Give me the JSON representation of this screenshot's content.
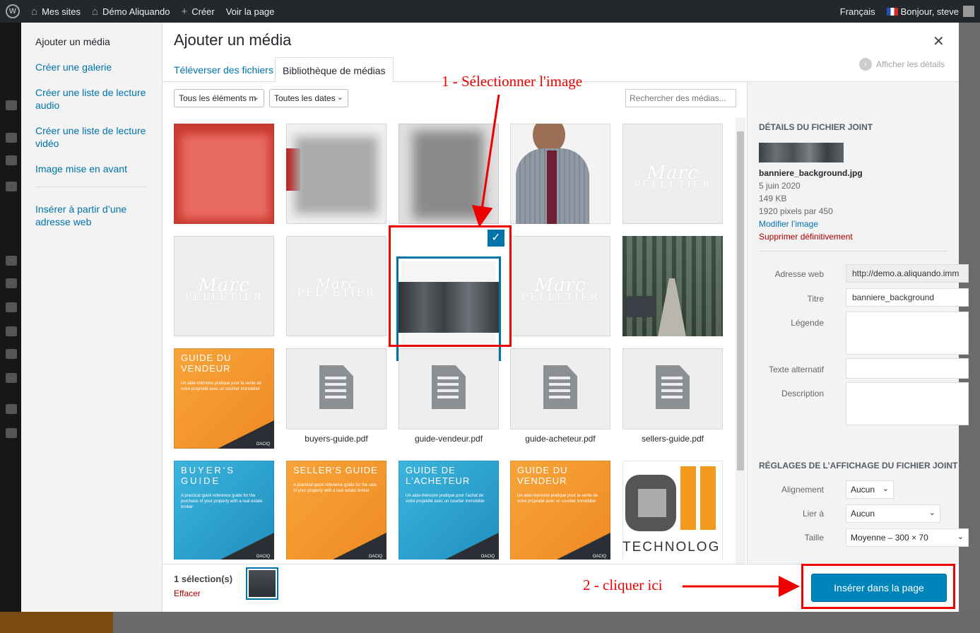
{
  "admin_bar": {
    "my_sites": "Mes sites",
    "site_name": "Démo Aliquando",
    "new": "Créer",
    "view_page": "Voir la page",
    "language": "Français",
    "greeting": "Bonjour, steve"
  },
  "modal": {
    "title": "Ajouter un média",
    "menu": [
      "Ajouter un média",
      "Créer une galerie",
      "Créer une liste de lecture audio",
      "Créer une liste de lecture vidéo",
      "Image mise en avant",
      "Insérer à partir d’une adresse web"
    ],
    "tabs": [
      "Téléverser des fichiers",
      "Bibliothèque de médias"
    ],
    "show_details": "Afficher les détails",
    "filter_type": "Tous les éléments m",
    "filter_date": "Toutes les dates",
    "search_placeholder": "Rechercher des médias...",
    "files": [
      "buyers-guide.pdf",
      "guide-vendeur.pdf",
      "guide-acheteur.pdf",
      "sellers-guide.pdf"
    ],
    "thumb_text": {
      "marc": "Marc",
      "pelletier": "PELLETIER",
      "guide_vendeur": "GUIDE DU VENDEUR",
      "guide_vendeur_sub": "Un aide-mémoire pratique pour la vente de votre propriété avec un courtier immobilier",
      "buyers_guide": "BUYER'S GUIDE",
      "buyers_guide_sub": "A practical quick reference guide for the purchase of your property with a real estate broker",
      "sellers_guide": "SELLER'S GUIDE",
      "sellers_guide_sub": "A practical quick reference guide for the sale of your property with a real estate broker",
      "guide_acheteur": "GUIDE DE L'ACHETEUR",
      "guide_acheteur_sub": "Un aide-mémoire pratique pour l'achat de votre propriété avec un courtier immobilier",
      "oacio": "OACIQ",
      "technology": "TECHNOLOG"
    }
  },
  "details": {
    "heading": "Détails du fichier joint",
    "filename": "banniere_background.jpg",
    "date": "5 juin 2020",
    "size": "149 KB",
    "dimensions": "1920 pixels par 450",
    "edit": "Modifier l’image",
    "delete": "Supprimer définitivement",
    "url_label": "Adresse web",
    "url_value": "http://demo.a.aliquando.imm",
    "title_label": "Titre",
    "title_value": "banniere_background",
    "caption_label": "Légende",
    "alt_label": "Texte alternatif",
    "desc_label": "Description",
    "display_heading": "Réglages de l’affichage du fichier joint",
    "align_label": "Alignement",
    "align_value": "Aucun",
    "link_label": "Lier à",
    "link_value": "Aucun",
    "size_label": "Taille",
    "size_value": "Moyenne – 300 × 70"
  },
  "footer": {
    "selection_count": "1 sélection(s)",
    "clear": "Effacer",
    "insert_button": "Insérer dans la page"
  },
  "annotations": {
    "step1": "1 - Sélectionner l'image",
    "step2": "2 - cliquer ici"
  },
  "colors": {
    "accent": "#0073aa",
    "primary_button": "#0085ba",
    "annotation": "#ee0000",
    "guide_orange": "#f39a2c",
    "guide_blue": "#2aa6d0"
  }
}
